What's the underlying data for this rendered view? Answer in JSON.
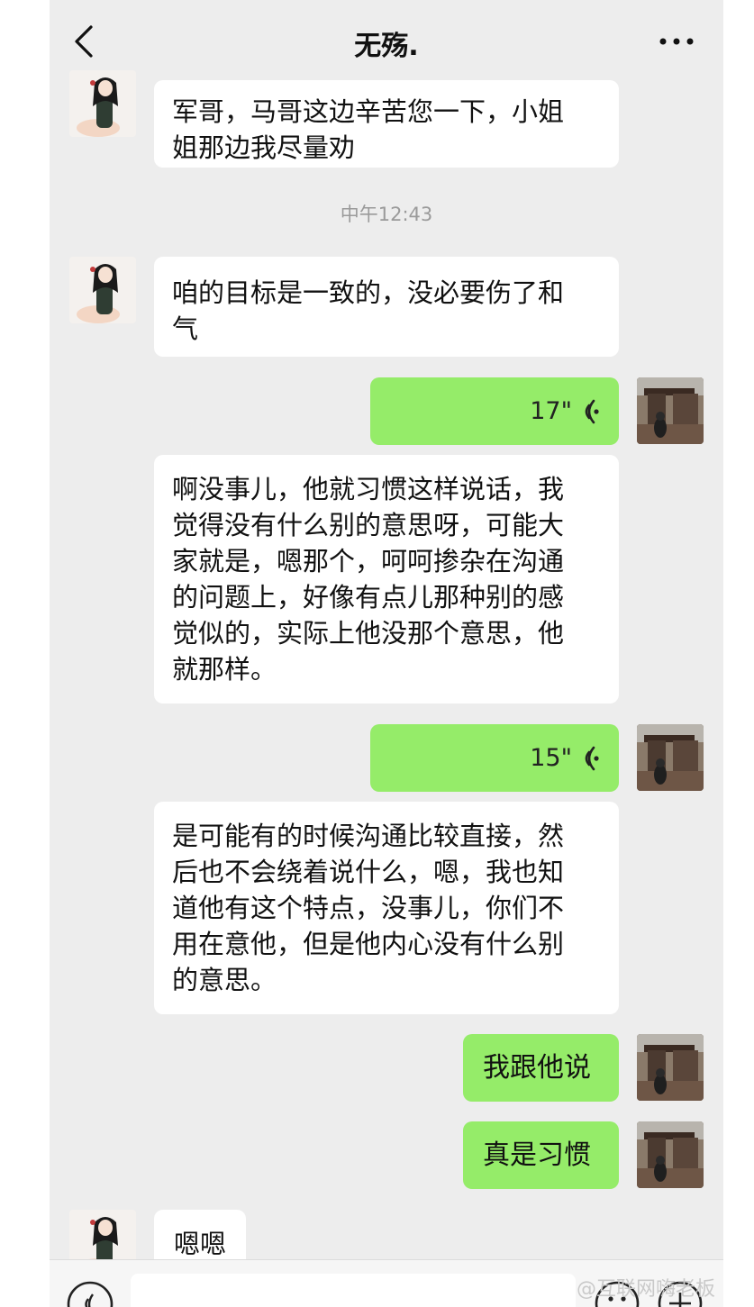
{
  "header": {
    "title": "无殇.",
    "back_icon": "chevron-left-icon",
    "more_icon": "more-dots-icon"
  },
  "messages": [
    {
      "from": "contact",
      "type": "text",
      "lines": [
        "军哥，马哥这边辛苦您一下，小姐",
        "姐那边我尽量劝"
      ]
    },
    {
      "type": "timestamp",
      "text": "中午12:43"
    },
    {
      "from": "contact",
      "type": "text",
      "lines": [
        "咱的目标是一致的，没必要伤了和",
        "气"
      ]
    },
    {
      "from": "me",
      "type": "voice",
      "duration": "17\""
    },
    {
      "from": "contact",
      "type": "text",
      "lines": [
        "啊没事儿，他就习惯这样说话，我",
        "觉得没有什么别的意思呀，可能大",
        "家就是，嗯那个，呵呵掺杂在沟通",
        "的问题上，好像有点儿那种别的感",
        "觉似的，实际上他没那个意思，他",
        "就那样。"
      ]
    },
    {
      "from": "me",
      "type": "voice",
      "duration": "15\""
    },
    {
      "from": "contact",
      "type": "text",
      "lines": [
        "是可能有的时候沟通比较直接，然",
        "后也不会绕着说什么，嗯，我也知",
        "道他有这个特点，没事儿，你们不",
        "用在意他，但是他内心没有什么别",
        "的意思。"
      ]
    },
    {
      "from": "me",
      "type": "text",
      "text": "我跟他说"
    },
    {
      "from": "me",
      "type": "text",
      "text": "真是习惯"
    },
    {
      "from": "contact",
      "type": "text",
      "text": "嗯嗯"
    }
  ],
  "watermark": "@互联网嗨老板",
  "colors": {
    "background": "#ededed",
    "outgoing_bubble": "#95ec69",
    "incoming_bubble": "#ffffff"
  },
  "input_bar": {
    "voice_icon": "voice-input-icon",
    "emoji_icon": "emoji-icon",
    "plus_icon": "plus-circle-icon"
  }
}
